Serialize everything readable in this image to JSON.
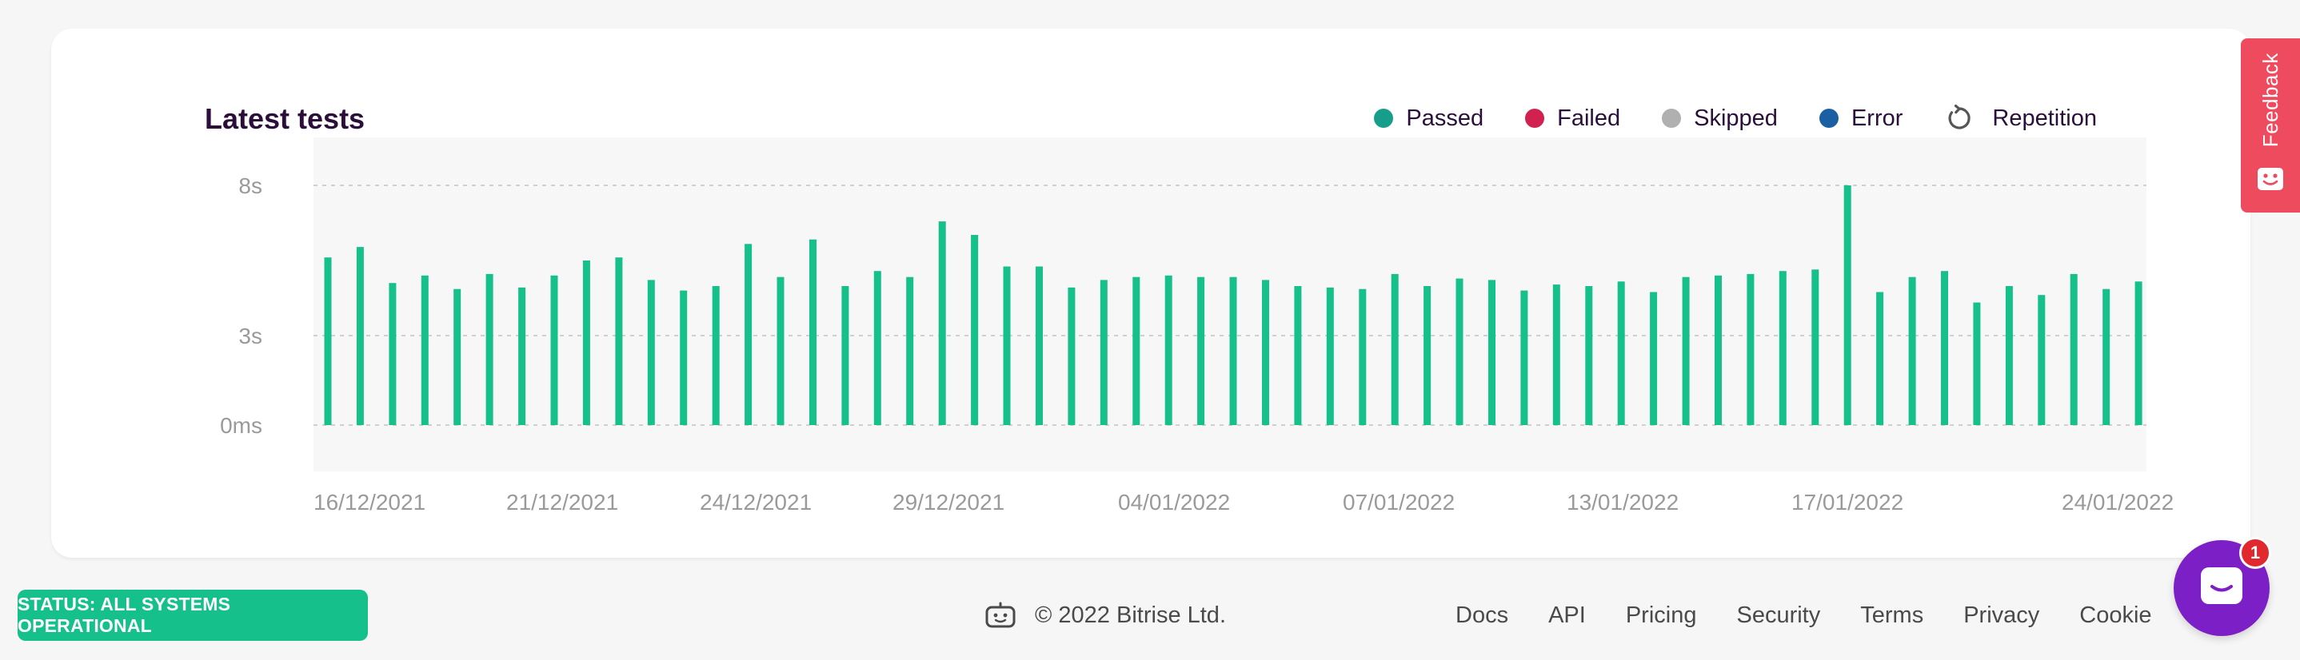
{
  "card": {
    "title": "Latest tests",
    "legend": [
      {
        "label": "Passed",
        "color": "#169e8a",
        "icon": "dot"
      },
      {
        "label": "Failed",
        "color": "#d1224f",
        "icon": "dot"
      },
      {
        "label": "Skipped",
        "color": "#b0b0b0",
        "icon": "dot"
      },
      {
        "label": "Error",
        "color": "#1b5fa3",
        "icon": "dot"
      },
      {
        "label": "Repetition",
        "color": "#555555",
        "icon": "repeat-icon"
      }
    ]
  },
  "chart_data": {
    "type": "bar",
    "title": "Latest tests",
    "y_ticks": [
      {
        "label": "8s",
        "value": 8
      },
      {
        "label": "3s",
        "value": 3
      },
      {
        "label": "0ms",
        "value": 0
      }
    ],
    "ylim": [
      0,
      8
    ],
    "grid": "dashed horizontal at ticks",
    "bar_color": "#16c08a",
    "series": [
      {
        "values": [
          5.6,
          5.95,
          4.75,
          5.0,
          4.55,
          5.05,
          4.6,
          5.0,
          5.5,
          5.6,
          4.85,
          4.5,
          4.65,
          6.05,
          4.95,
          6.2,
          4.65,
          5.15,
          4.95,
          6.8,
          6.35,
          5.3,
          5.3,
          4.6,
          4.85,
          4.95,
          5.0,
          4.95,
          4.95,
          4.85,
          4.65,
          4.6,
          4.55,
          5.05,
          4.65,
          4.9,
          4.85,
          4.5,
          4.7,
          4.65,
          4.8,
          4.45,
          4.95,
          5.0,
          5.05,
          5.15,
          5.2,
          8.0,
          4.45,
          4.95,
          5.15,
          4.1,
          4.65,
          4.35,
          5.05,
          4.55,
          4.8
        ]
      }
    ],
    "x_tick_labels": [
      "16/12/2021",
      "21/12/2021",
      "24/12/2021",
      "29/12/2021",
      "04/01/2022",
      "07/01/2022",
      "13/01/2022",
      "17/01/2022",
      "24/01/2022"
    ]
  },
  "feedback": {
    "label": "Feedback"
  },
  "footer": {
    "status": "STATUS: ALL SYSTEMS OPERATIONAL",
    "copyright": "© 2022 Bitrise Ltd.",
    "links": [
      "Docs",
      "API",
      "Pricing",
      "Security",
      "Terms",
      "Privacy",
      "Cookie"
    ]
  },
  "chat": {
    "badge": "1"
  }
}
